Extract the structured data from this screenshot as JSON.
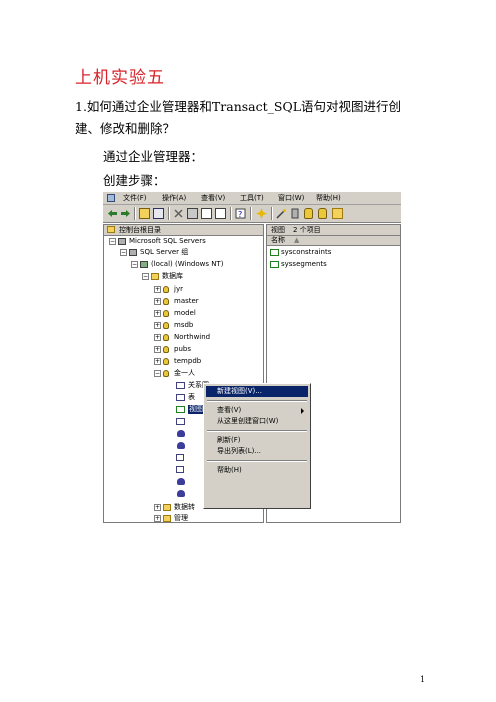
{
  "document": {
    "title": "上机实验五",
    "question": "1.如何通过企业管理器和Transact_SQL语句对视图进行创建、修改和删除？",
    "para1": "通过企业管理器：",
    "para2": "创建步骤：",
    "page_number": "1"
  },
  "screenshot": {
    "menu": [
      "文件(F)",
      "操作(A)",
      "查看(V)",
      "工具(T)",
      "窗口(W)",
      "帮助(H)"
    ],
    "tree_header": "控制台根目录",
    "tree": {
      "root": "Microsoft SQL Servers",
      "group": "SQL Server 组",
      "server": "(local) (Windows NT)",
      "databases": "数据库",
      "dbs": [
        "jyr",
        "master",
        "model",
        "msdb",
        "Northwind",
        "pubs",
        "tempdb",
        "金一人"
      ],
      "diagrams": "关系图",
      "tables": "表",
      "views": "视图",
      "partial_dts": "数据转",
      "management": "管理"
    },
    "right_header": {
      "label": "视图",
      "count": "2 个项目"
    },
    "right_column": "名称",
    "right_items": [
      "sysconstraints",
      "syssegments"
    ],
    "context_menu": {
      "new_view": "新建视图(V)...",
      "view": "查看(V)",
      "new_window": "从这里创建窗口(W)",
      "refresh": "刷新(F)",
      "export": "导出列表(L)...",
      "help": "帮助(H)"
    },
    "colors": {
      "highlight": "#0a246a",
      "title_red": "#d8232a",
      "chrome": "#d4d0c8"
    }
  }
}
